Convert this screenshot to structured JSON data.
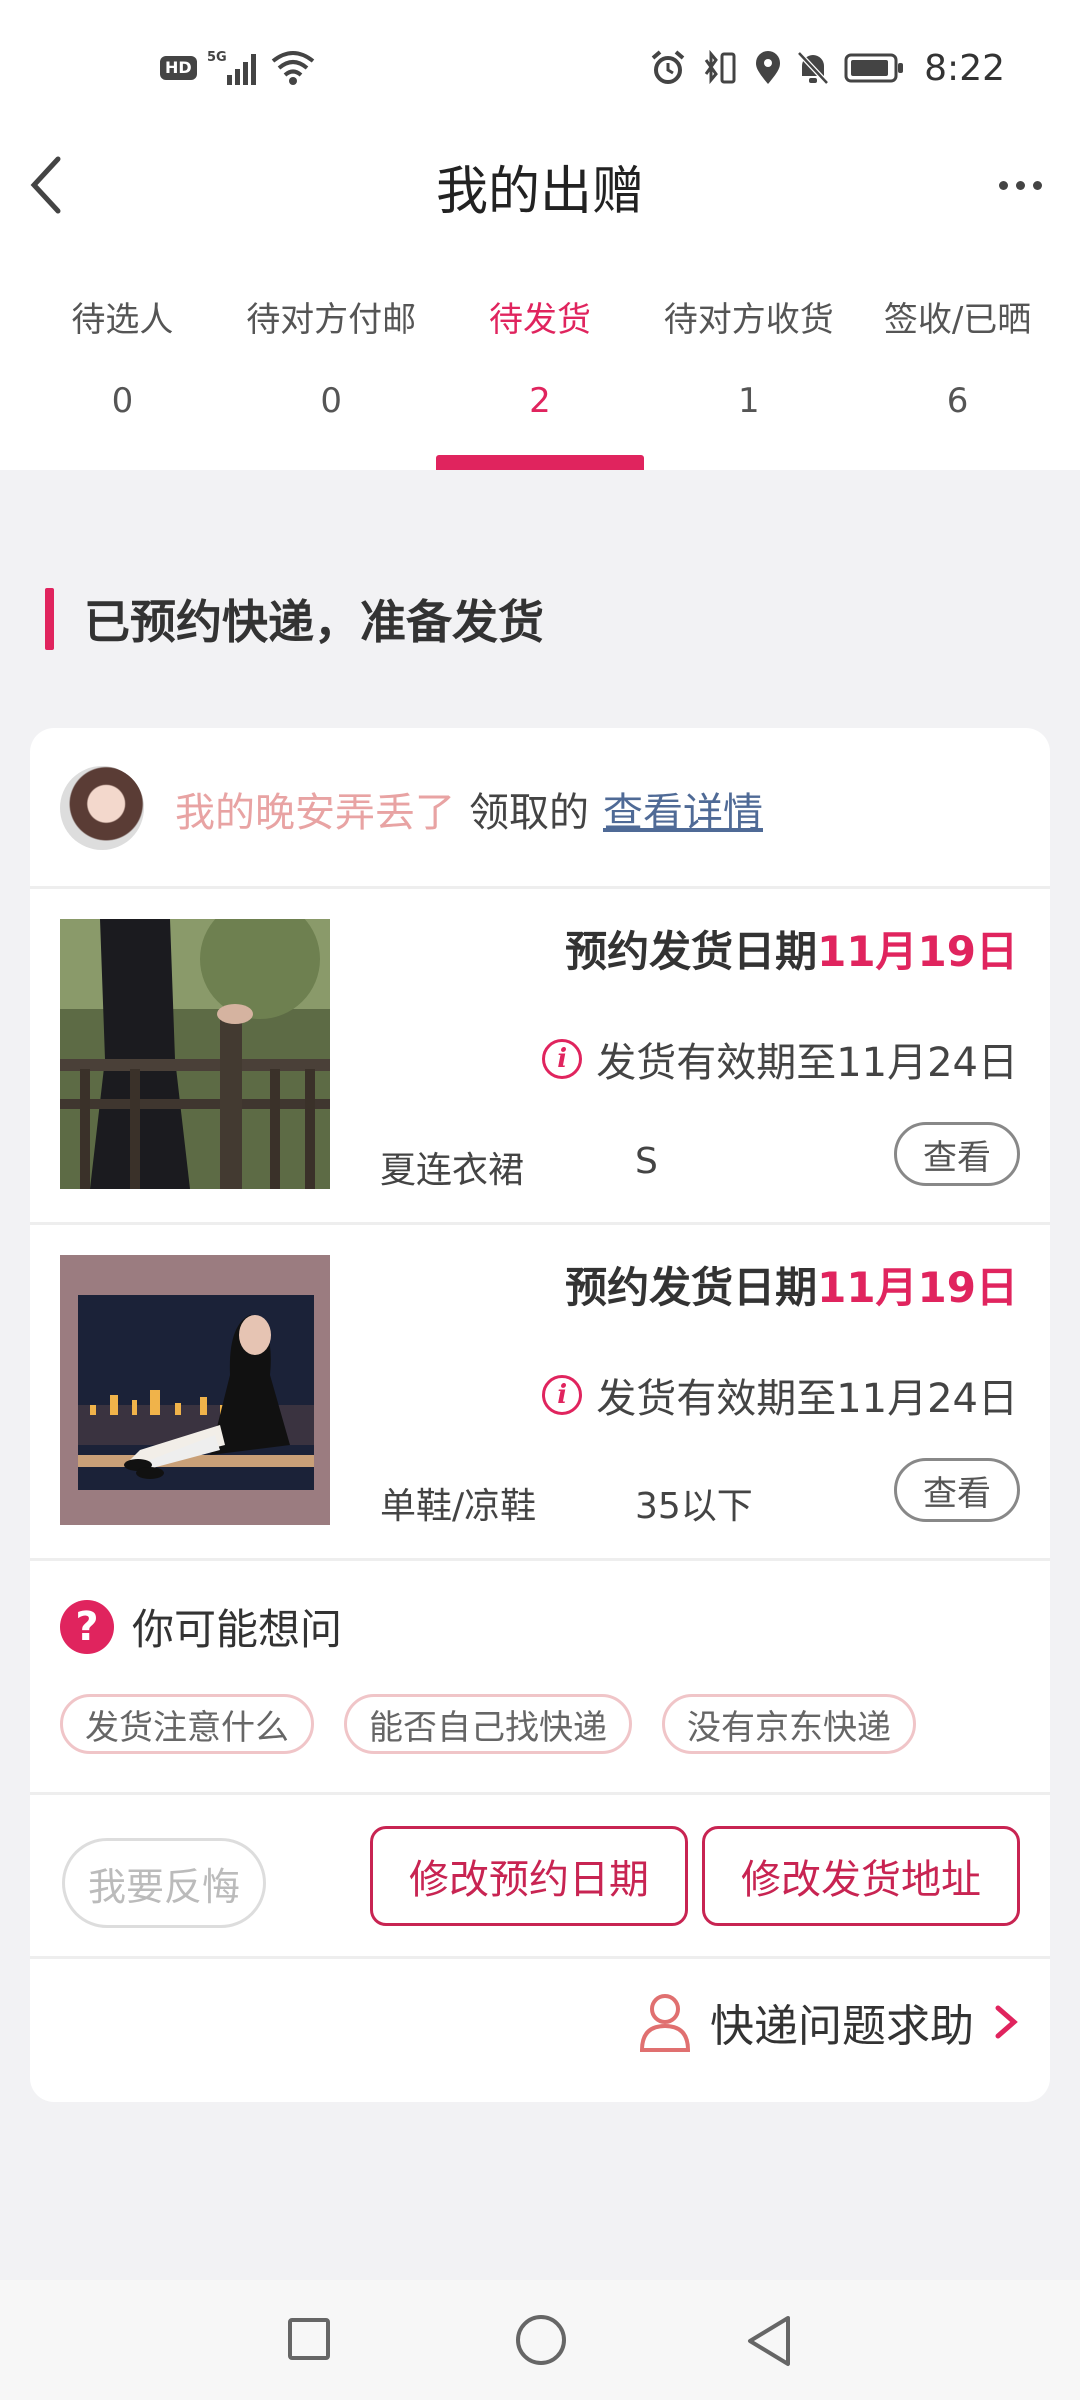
{
  "status_bar": {
    "hd_label": "HD",
    "network_label": "5G",
    "time": "8:22"
  },
  "header": {
    "title": "我的出赠",
    "back_icon": "chevron-left-icon",
    "more_icon": "more-horizontal-icon"
  },
  "tabs": [
    {
      "label": "待选人",
      "count": "0",
      "active": false
    },
    {
      "label": "待对方付邮",
      "count": "0",
      "active": false
    },
    {
      "label": "待发货",
      "count": "2",
      "active": true
    },
    {
      "label": "待对方收货",
      "count": "1",
      "active": false
    },
    {
      "label": "签收/已晒",
      "count": "6",
      "active": false
    }
  ],
  "section": {
    "title": "已预约快递，准备发货"
  },
  "recipient": {
    "user_name": "我的晚安弄丢了",
    "action_label": "领取的",
    "detail_link": "查看详情"
  },
  "items": [
    {
      "date_label": "预约发货日期",
      "date_value": "11月19日",
      "validity": "发货有效期至11月24日",
      "category": "夏连衣裙",
      "size": "S",
      "view_label": "查看"
    },
    {
      "date_label": "预约发货日期",
      "date_value": "11月19日",
      "validity": "发货有效期至11月24日",
      "category": "单鞋/凉鞋",
      "size": "35以下",
      "view_label": "查看"
    }
  ],
  "faq": {
    "title": "你可能想问",
    "chips": [
      "发货注意什么",
      "能否自己找快递",
      "没有京东快递"
    ]
  },
  "actions": {
    "regret": "我要反悔",
    "change_date": "修改预约日期",
    "change_address": "修改发货地址"
  },
  "help": {
    "label": "快递问题求助"
  },
  "colors": {
    "accent": "#e0245e",
    "link": "#4f6a96",
    "user_name": "#e8a3a3"
  }
}
